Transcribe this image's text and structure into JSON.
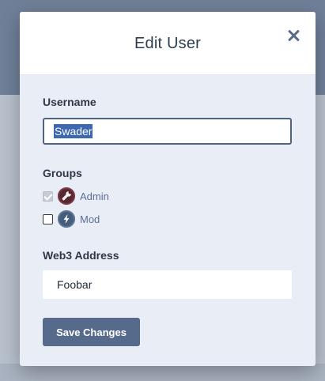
{
  "modal": {
    "title": "Edit User",
    "username": {
      "label": "Username",
      "value": "Swader"
    },
    "groups": {
      "label": "Groups",
      "items": [
        {
          "label": "Admin",
          "checked": true,
          "disabled": true,
          "icon": "wrench-icon"
        },
        {
          "label": "Mod",
          "checked": false,
          "disabled": false,
          "icon": "lightning-icon"
        }
      ]
    },
    "web3": {
      "label": "Web3 Address",
      "value": "Foobar"
    },
    "save_label": "Save Changes"
  },
  "colors": {
    "button": "#566a8b",
    "input_focus_border": "#4f6481",
    "group_label": "#5d6d98",
    "admin_badge": "#5a2730",
    "mod_badge": "#455d7a"
  }
}
